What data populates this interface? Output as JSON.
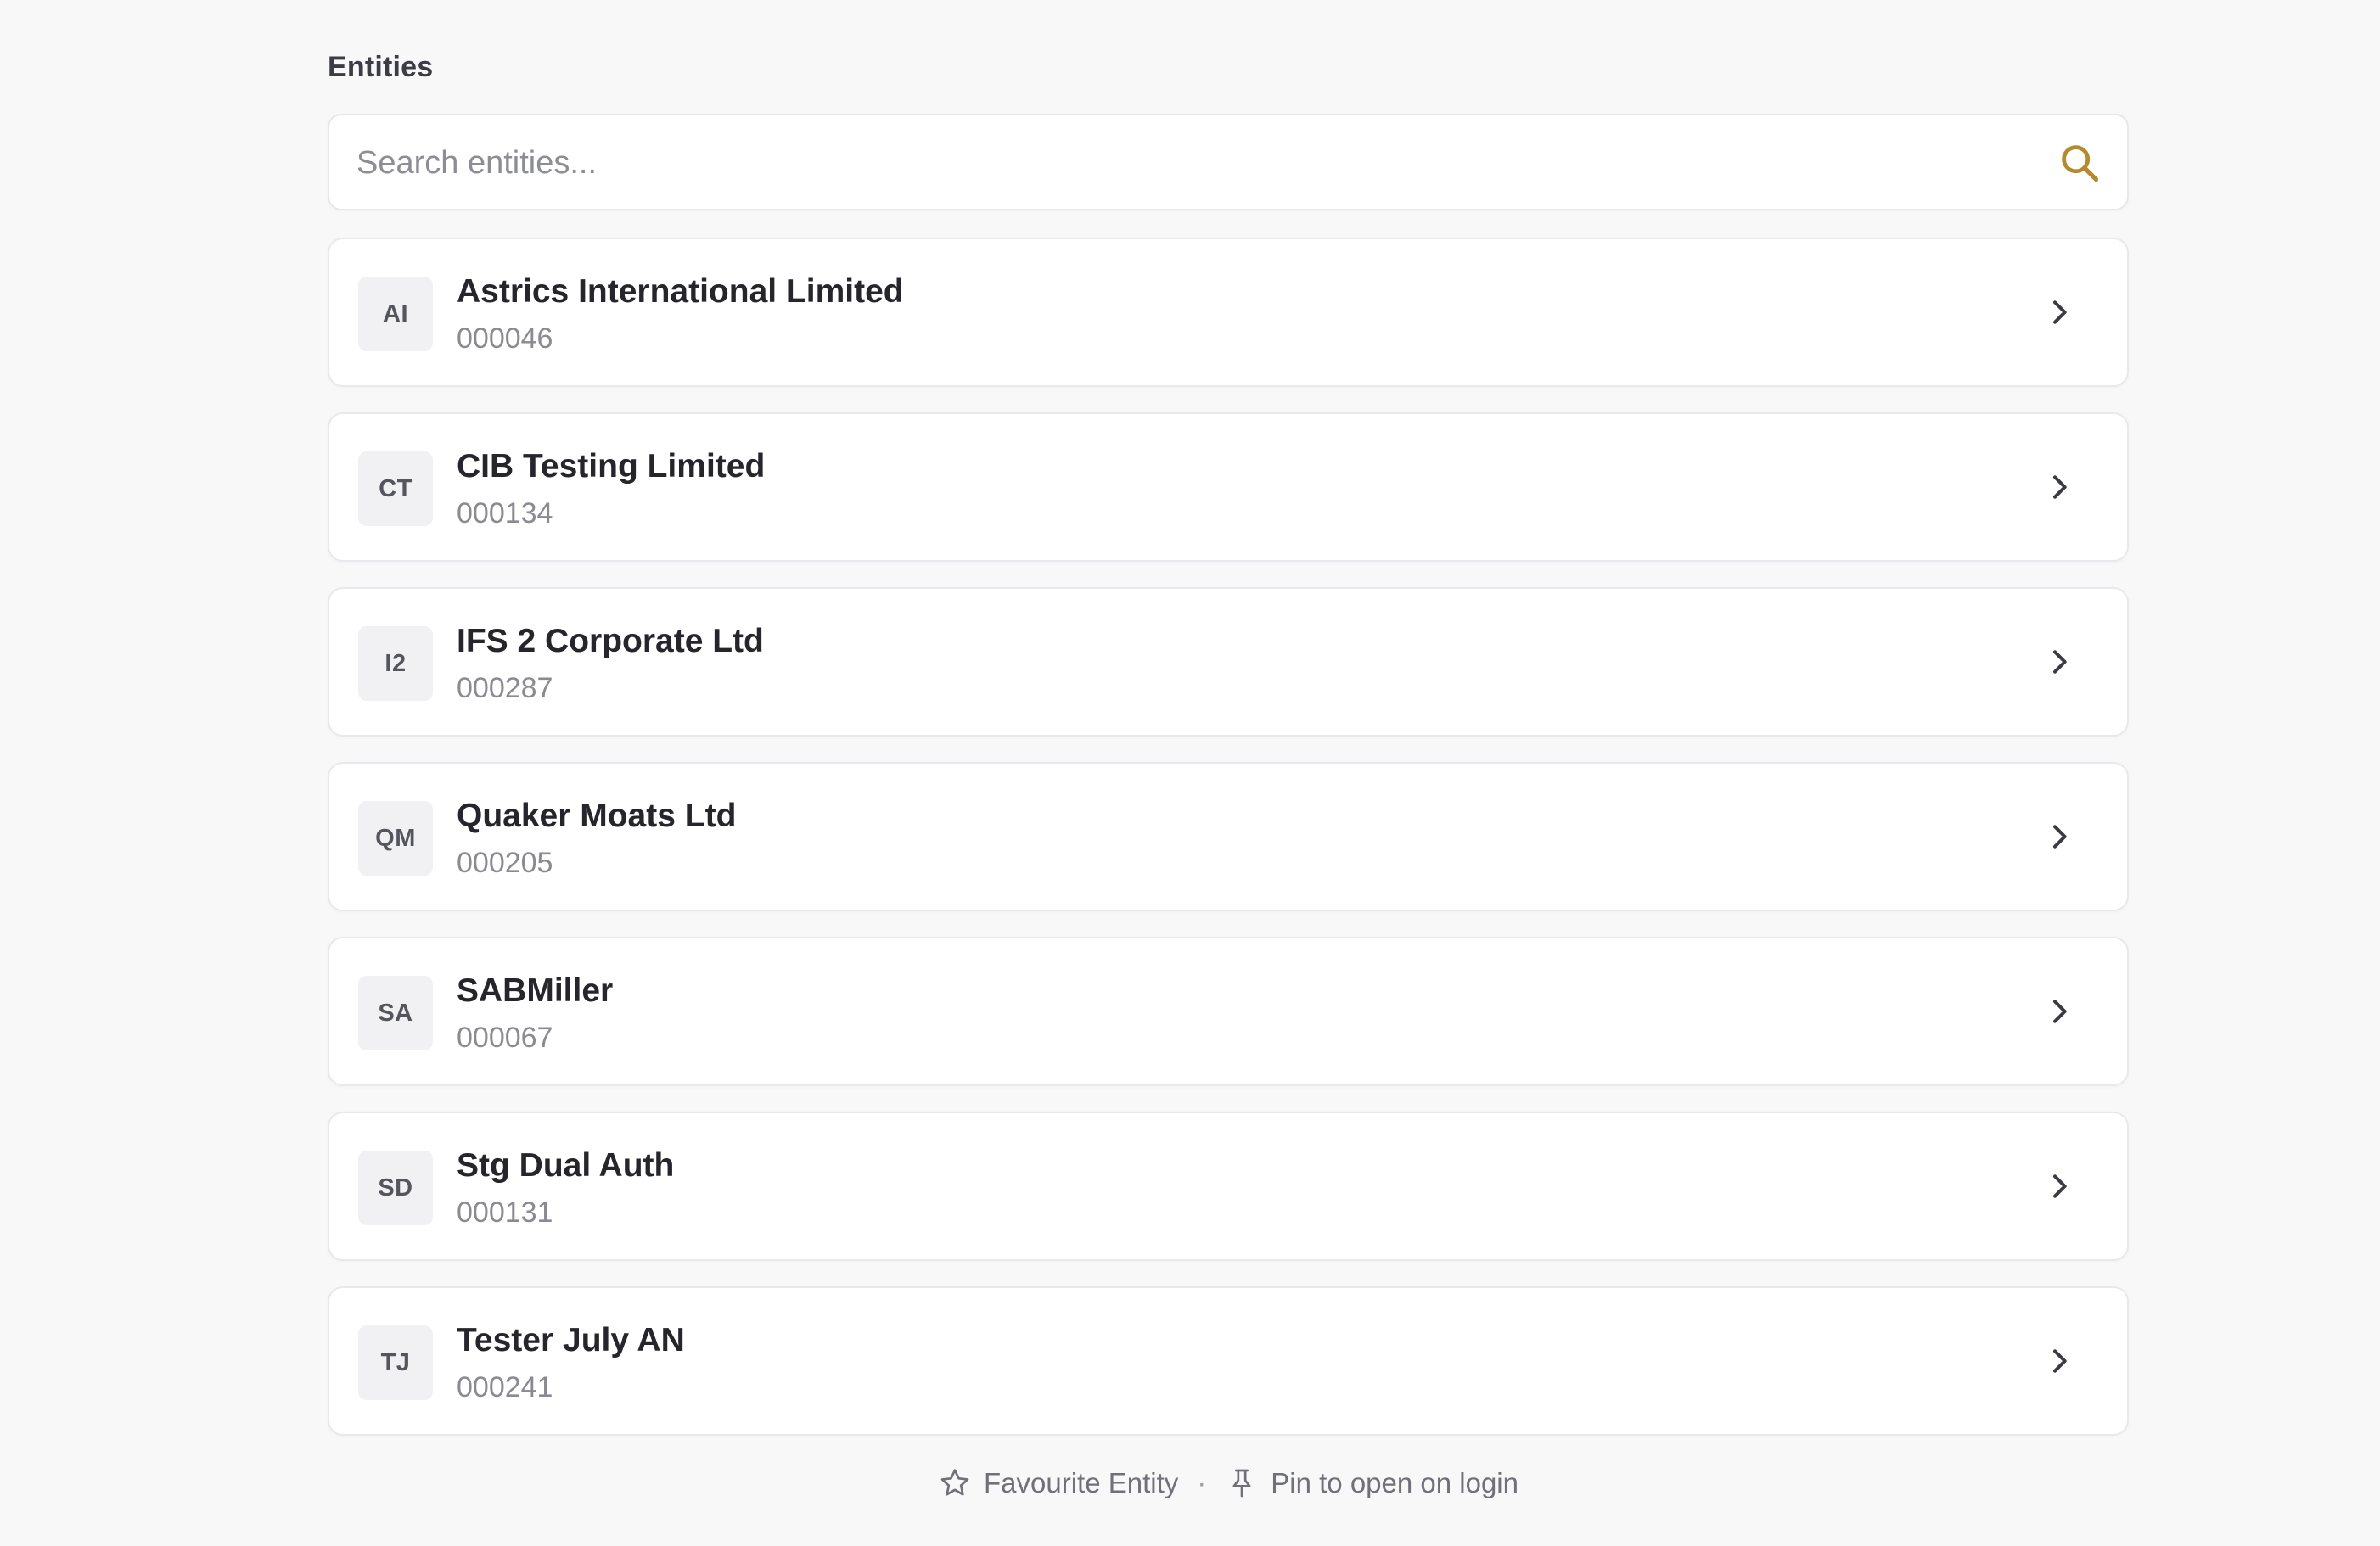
{
  "section": {
    "title": "Entities"
  },
  "search": {
    "placeholder": "Search entities...",
    "value": "",
    "icon": "search-icon",
    "icon_color": "#b38a2e"
  },
  "entities": [
    {
      "initials": "AI",
      "name": "Astrics International Limited",
      "code": "000046"
    },
    {
      "initials": "CT",
      "name": "CIB Testing Limited",
      "code": "000134"
    },
    {
      "initials": "I2",
      "name": "IFS 2 Corporate Ltd",
      "code": "000287"
    },
    {
      "initials": "QM",
      "name": "Quaker Moats Ltd",
      "code": "000205"
    },
    {
      "initials": "SA",
      "name": "SABMiller",
      "code": "000067"
    },
    {
      "initials": "SD",
      "name": "Stg Dual Auth",
      "code": "000131"
    },
    {
      "initials": "TJ",
      "name": "Tester July AN",
      "code": "000241"
    }
  ],
  "footer": {
    "favourite_icon": "star-icon",
    "favourite_label": "Favourite Entity",
    "separator": "·",
    "pin_icon": "pin-icon",
    "pin_label": "Pin to open on login"
  },
  "colors": {
    "background": "#f8f8f9",
    "card": "#ffffff",
    "accent": "#b38a2e"
  }
}
